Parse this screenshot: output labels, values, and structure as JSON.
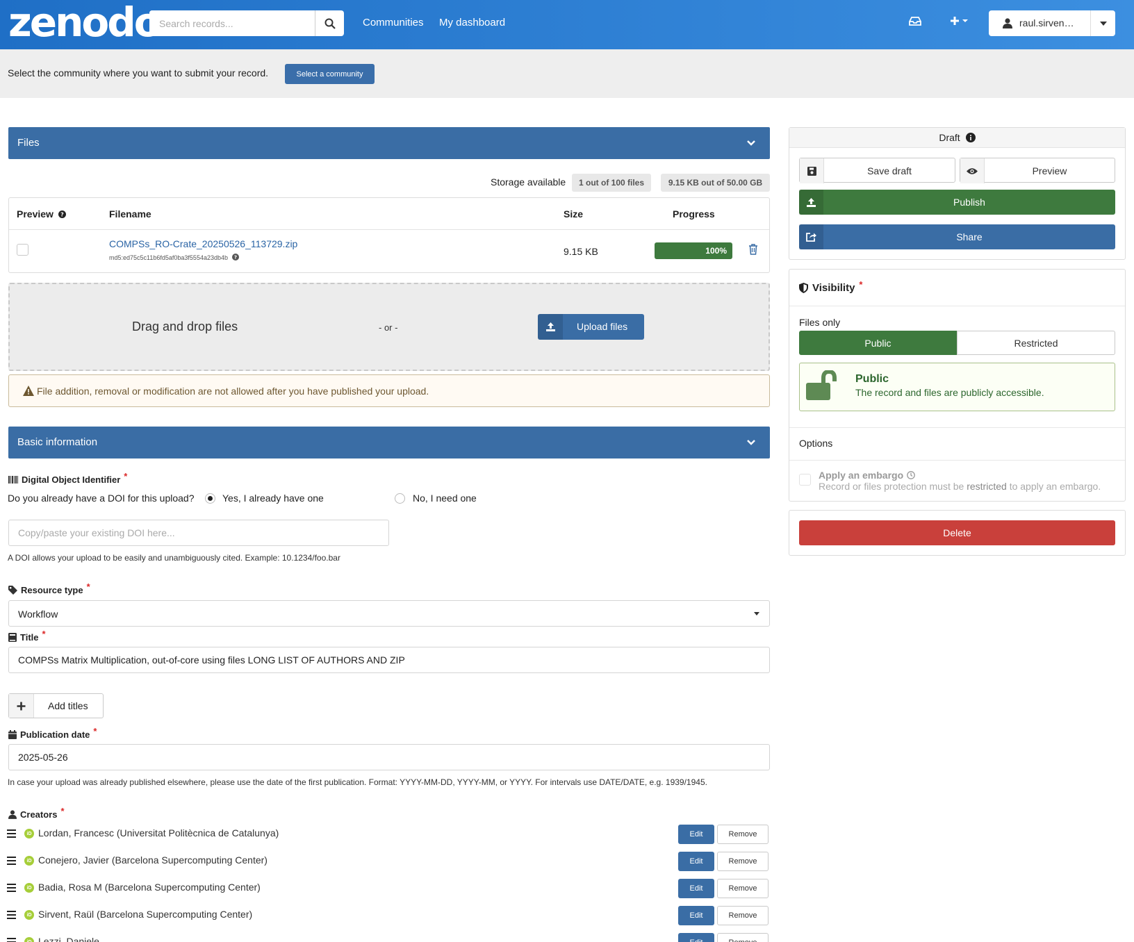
{
  "header": {
    "logo": "zenodo",
    "search_placeholder": "Search records...",
    "nav": [
      "Communities",
      "My dashboard"
    ],
    "user": "raul.sirven…"
  },
  "community_bar": {
    "text": "Select the community where you want to submit your record.",
    "button": "Select a community"
  },
  "files": {
    "section_title": "Files",
    "storage_label": "Storage available",
    "files_count": "1 out of 100 files",
    "storage_used": "9.15 KB out of 50.00 GB",
    "columns": [
      "Preview",
      "Filename",
      "Size",
      "Progress"
    ],
    "file": {
      "name": "COMPSs_RO-Crate_20250526_113729.zip",
      "md5": "md5:ed75c5c11b6fd5af0ba3f5554a23db4b",
      "size": "9.15 KB",
      "progress_label": "100%",
      "progress": 1.0
    },
    "drag_text": "Drag and drop files",
    "or_text": "- or -",
    "upload_button": "Upload files",
    "warning": "File addition, removal or modification are not allowed after you have published your upload."
  },
  "basic": {
    "section_title": "Basic information",
    "doi_label": "Digital Object Identifier",
    "doi_question": "Do you already have a DOI for this upload?",
    "doi_yes": "Yes, I already have one",
    "doi_no": "No, I need one",
    "doi_placeholder": "Copy/paste your existing DOI here...",
    "doi_help": "A DOI allows your upload to be easily and unambiguously cited. Example: 10.1234/foo.bar",
    "resource_label": "Resource type",
    "resource_value": "Workflow",
    "title_label": "Title",
    "title_value": "COMPSs Matrix Multiplication, out-of-core using files LONG LIST OF AUTHORS AND ZIP",
    "add_titles": "Add titles",
    "pubdate_label": "Publication date",
    "pubdate_value": "2025-05-26",
    "pubdate_help": "In case your upload was already published elsewhere, please use the date of the first publication. Format: YYYY-MM-DD, YYYY-MM, or YYYY. For intervals use DATE/DATE, e.g. 1939/1945.",
    "creators_label": "Creators",
    "required_mark": "*",
    "edit_label": "Edit",
    "remove_label": "Remove",
    "creators": [
      "Lordan, Francesc (Universitat Politècnica de Catalunya)",
      "Conejero, Javier (Barcelona Supercomputing Center)",
      "Badia, Rosa M (Barcelona Supercomputing Center)",
      "Sirvent, Raül (Barcelona Supercomputing Center)",
      "Lezzi, Daniele"
    ]
  },
  "sidebar": {
    "status": "Draft",
    "save_draft": "Save draft",
    "preview": "Preview",
    "publish": "Publish",
    "share": "Share",
    "visibility_title": "Visibility",
    "files_only": "Files only",
    "public": "Public",
    "restricted": "Restricted",
    "public_title": "Public",
    "public_desc": "The record and files are publicly accessible.",
    "options": "Options",
    "embargo_title": "Apply an embargo",
    "embargo_desc_pre": "Record or files protection must be",
    "embargo_desc_bold": "restricted",
    "embargo_desc_post": "to apply an embargo.",
    "delete": "Delete"
  },
  "colors": {
    "header_blue": "#1f6fc6",
    "section_blue": "#3a6da5",
    "green": "#3e7a3e",
    "red": "#c9403b"
  }
}
